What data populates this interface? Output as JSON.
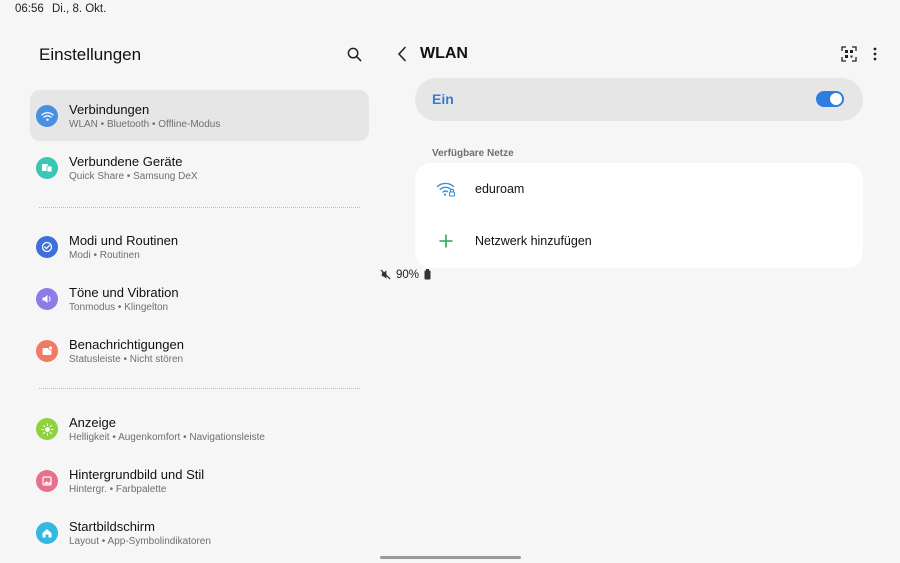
{
  "status_bar": {
    "time": "06:56",
    "date": "Di., 8. Okt.",
    "battery": "90%"
  },
  "left_pane": {
    "title": "Einstellungen",
    "search_icon": "search-icon",
    "items": [
      {
        "title": "Verbindungen",
        "subtitle": "WLAN • Bluetooth • Offline-Modus",
        "icon": "wifi-icon",
        "color": "#4a90e2",
        "selected": true
      },
      {
        "title": "Verbundene Geräte",
        "subtitle": "Quick Share • Samsung DeX",
        "icon": "devices-icon",
        "color": "#3cc6b5",
        "selected": false
      },
      {
        "title": "Modi und Routinen",
        "subtitle": "Modi • Routinen",
        "icon": "check-circle-icon",
        "color": "#3f6fd8",
        "selected": false
      },
      {
        "title": "Töne und Vibration",
        "subtitle": "Tonmodus • Klingelton",
        "icon": "speaker-icon",
        "color": "#8f7be8",
        "selected": false
      },
      {
        "title": "Benachrichtigungen",
        "subtitle": "Statusleiste • Nicht stören",
        "icon": "notification-icon",
        "color": "#ef7b66",
        "selected": false
      },
      {
        "title": "Anzeige",
        "subtitle": "Helligkeit • Augenkomfort • Navigationsleiste",
        "icon": "sun-icon",
        "color": "#8fd13f",
        "selected": false
      },
      {
        "title": "Hintergrundbild und Stil",
        "subtitle": "Hintergr. • Farbpalette",
        "icon": "wallpaper-icon",
        "color": "#e8708f",
        "selected": false
      },
      {
        "title": "Startbildschirm",
        "subtitle": "Layout • App-Symbolindikatoren",
        "icon": "home-icon",
        "color": "#34b8e0",
        "selected": false
      }
    ]
  },
  "right_pane": {
    "title": "WLAN",
    "toggle_label": "Ein",
    "toggle_on": true,
    "section_label": "Verfügbare Netze",
    "networks": [
      {
        "label": "eduroam",
        "icon": "wifi-lock-icon"
      },
      {
        "label": "Netzwerk hinzufügen",
        "icon": "plus-icon"
      }
    ]
  },
  "colors": {
    "accent": "#2f7de1",
    "toggle_label": "#3a7bd5",
    "add_green": "#2fa84f"
  }
}
